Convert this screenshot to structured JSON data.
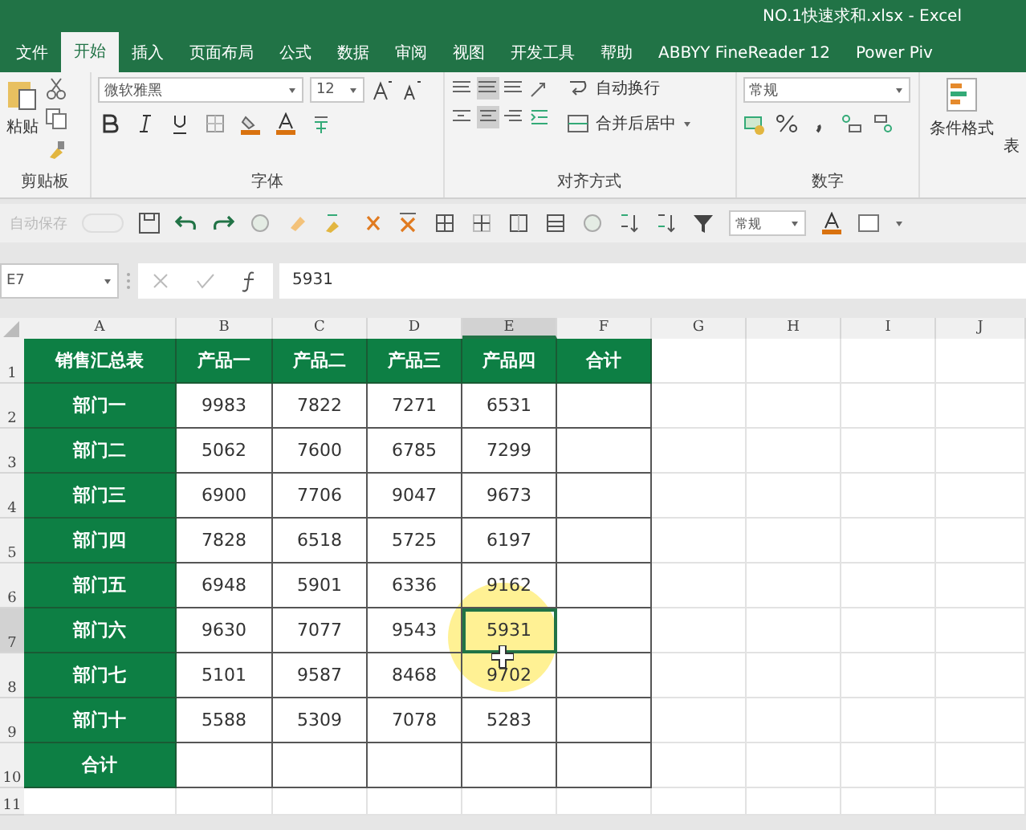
{
  "window": {
    "title": "NO.1快速求和.xlsx  -  Excel"
  },
  "tabs": [
    {
      "label": "文件",
      "selected": false
    },
    {
      "label": "开始",
      "selected": true
    },
    {
      "label": "插入",
      "selected": false
    },
    {
      "label": "页面布局",
      "selected": false
    },
    {
      "label": "公式",
      "selected": false
    },
    {
      "label": "数据",
      "selected": false
    },
    {
      "label": "审阅",
      "selected": false
    },
    {
      "label": "视图",
      "selected": false
    },
    {
      "label": "开发工具",
      "selected": false
    },
    {
      "label": "帮助",
      "selected": false
    },
    {
      "label": "ABBYY FineReader 12",
      "selected": false
    },
    {
      "label": "Power Piv",
      "selected": false
    }
  ],
  "ribbon": {
    "clipboard": {
      "paste_label": "粘贴",
      "group_label": "剪贴板"
    },
    "font": {
      "font_name": "微软雅黑",
      "font_size": "12",
      "group_label": "字体"
    },
    "alignment": {
      "wrap_label": "自动换行",
      "merge_label": "合并后居中",
      "group_label": "对齐方式"
    },
    "number": {
      "format": "常规",
      "group_label": "数字"
    },
    "styles": {
      "conditional_label": "条件格式",
      "cut_label": "表"
    }
  },
  "quick_access": {
    "autosave_label": "自动保存",
    "autosave_disabled": true,
    "number_format": "常规"
  },
  "formula_bar": {
    "name_box": "E7",
    "formula": "5931"
  },
  "sheet": {
    "columns": [
      {
        "label": "A",
        "selected": false
      },
      {
        "label": "B",
        "selected": false
      },
      {
        "label": "C",
        "selected": false
      },
      {
        "label": "D",
        "selected": false
      },
      {
        "label": "E",
        "selected": true
      },
      {
        "label": "F",
        "selected": false
      },
      {
        "label": "G",
        "selected": false
      },
      {
        "label": "H",
        "selected": false
      },
      {
        "label": "I",
        "selected": false
      },
      {
        "label": "J",
        "selected": false
      }
    ],
    "rows": [
      {
        "number": "1",
        "kind": "header",
        "selected": false,
        "cells": [
          "销售汇总表",
          "产品一",
          "产品二",
          "产品三",
          "产品四",
          "合计"
        ]
      },
      {
        "number": "2",
        "kind": "data",
        "selected": false,
        "cells": [
          "部门一",
          "9983",
          "7822",
          "7271",
          "6531"
        ]
      },
      {
        "number": "3",
        "kind": "data",
        "selected": false,
        "cells": [
          "部门二",
          "5062",
          "7600",
          "6785",
          "7299"
        ]
      },
      {
        "number": "4",
        "kind": "data",
        "selected": false,
        "cells": [
          "部门三",
          "6900",
          "7706",
          "9047",
          "9673"
        ]
      },
      {
        "number": "5",
        "kind": "data",
        "selected": false,
        "cells": [
          "部门四",
          "7828",
          "6518",
          "5725",
          "6197"
        ]
      },
      {
        "number": "6",
        "kind": "data",
        "selected": false,
        "cells": [
          "部门五",
          "6948",
          "5901",
          "6336",
          "9162"
        ]
      },
      {
        "number": "7",
        "kind": "data",
        "selected": true,
        "cells": [
          "部门六",
          "9630",
          "7077",
          "9543",
          "5931"
        ]
      },
      {
        "number": "8",
        "kind": "data",
        "selected": false,
        "cells": [
          "部门七",
          "5101",
          "9587",
          "8468",
          "9702"
        ]
      },
      {
        "number": "9",
        "kind": "data",
        "selected": false,
        "cells": [
          "部门十",
          "5588",
          "5309",
          "7078",
          "5283"
        ]
      },
      {
        "number": "10",
        "kind": "data",
        "selected": false,
        "cells": [
          "合计"
        ]
      },
      {
        "number": "11",
        "kind": "empty",
        "selected": false,
        "cells": []
      }
    ]
  }
}
